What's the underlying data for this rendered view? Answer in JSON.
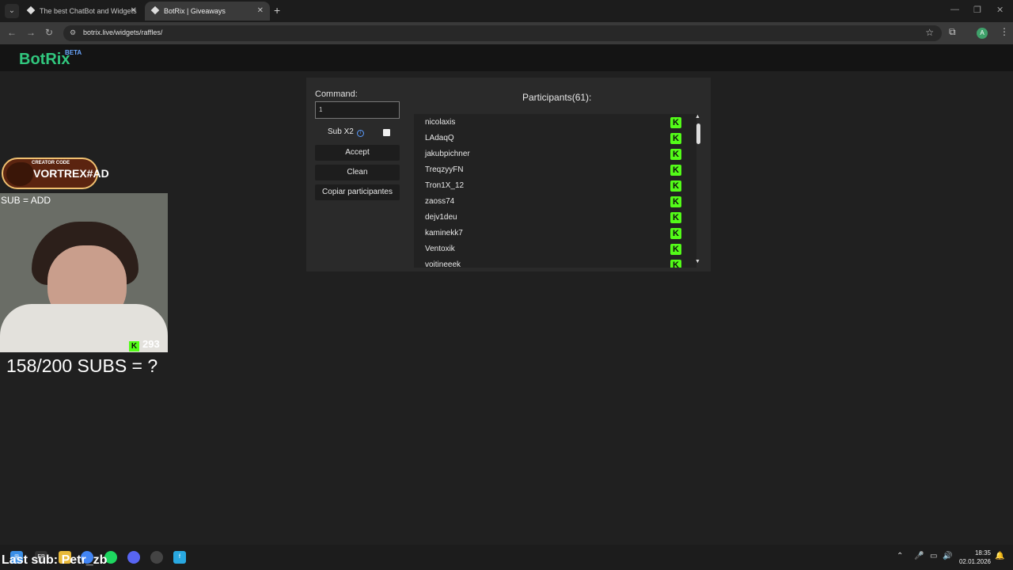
{
  "browser": {
    "tabs": [
      {
        "title": "The best ChatBot and Widgets",
        "active": false
      },
      {
        "title": "BotRix | Giveaways",
        "active": true
      }
    ],
    "url": "botrix.live/widgets/raffles/"
  },
  "site": {
    "logo": "BotRix",
    "badge": "BETA"
  },
  "raffle": {
    "command_label": "Command:",
    "command_value": "1",
    "sub_label": "Sub X2",
    "sub_checked": false,
    "accept_label": "Accept",
    "clean_label": "Clean",
    "copy_label": "Copiar participantes",
    "participants_title": "Participants(61):",
    "participants": [
      "nicolaxis",
      "LAdaqQ",
      "jakubpichner",
      "TreqzyyFN",
      "Tron1X_12",
      "zaoss74",
      "dejv1deu",
      "kaminekk7",
      "Ventoxik",
      "voitineeek"
    ]
  },
  "overlay": {
    "creator_code_label": "CREATOR CODE",
    "creator_code": "VORTREX#AD",
    "sub_add": "SUB = ADD",
    "viewer_count": "293",
    "subs_goal": "158/200 SUBS = ?",
    "last_sub": "Last sub: Petr_zb"
  },
  "taskbar": {
    "time": "18:35",
    "date": "02.01.2026"
  },
  "colors": {
    "brand": "#31c77e",
    "kick": "#53fc18",
    "beta": "#6aa6ff"
  }
}
